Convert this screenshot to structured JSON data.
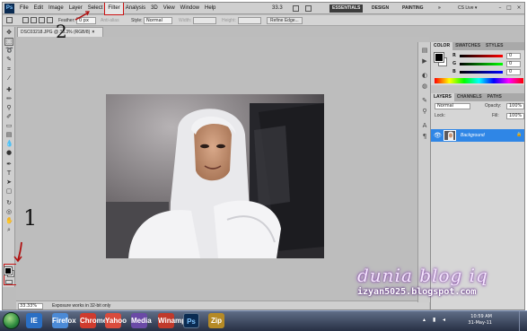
{
  "app": {
    "logo": "Ps",
    "zoom": "33.3"
  },
  "menu": [
    "File",
    "Edit",
    "Image",
    "Layer",
    "Select",
    "Filter",
    "Analysis",
    "3D",
    "View",
    "Window",
    "Help"
  ],
  "workspaces": [
    "ESSENTIALS",
    "DESIGN",
    "PAINTING",
    "»"
  ],
  "cs_live": "CS Live ▾",
  "options": {
    "feather_label": "Feather:",
    "feather_value": "0 px",
    "antialias": "Anti-alias",
    "style_label": "Style:",
    "style_value": "Normal",
    "width_label": "Width:",
    "height_label": "Height:",
    "refine_edge": "Refine Edge..."
  },
  "document": {
    "tab_title": "DSC03218.JPG @ 33.3% (RGB/8)",
    "close": "×"
  },
  "status": {
    "zoom": "33.33%",
    "message": "Exposure works in 32-bit only"
  },
  "color_panel": {
    "tabs": [
      "COLOR",
      "SWATCHES",
      "STYLES"
    ],
    "channels": [
      {
        "label": "R",
        "value": "0"
      },
      {
        "label": "G",
        "value": "0"
      },
      {
        "label": "B",
        "value": "0"
      }
    ]
  },
  "layers_panel": {
    "tabs": [
      "LAYERS",
      "CHANNELS",
      "PATHS"
    ],
    "blend_mode": "Normal",
    "opacity_label": "Opacity:",
    "opacity_value": "100%",
    "lock_label": "Lock:",
    "fill_label": "Fill:",
    "fill_value": "100%",
    "layer_name": "Background"
  },
  "taskbar": {
    "time": "10:59 AM",
    "date": "31-May-11",
    "apps": [
      "IE",
      "Firefox",
      "Chrome",
      "Yahoo",
      "Media",
      "Winamp",
      "Ps",
      "Zip"
    ]
  },
  "annotations": {
    "step1": "1",
    "step2": "2"
  },
  "watermark": {
    "title": "dunia blog iq",
    "url": "izyan5025.blogspot.com"
  },
  "colors": {
    "highlight": "#cc1010",
    "layer_selected": "#2f86e6"
  }
}
